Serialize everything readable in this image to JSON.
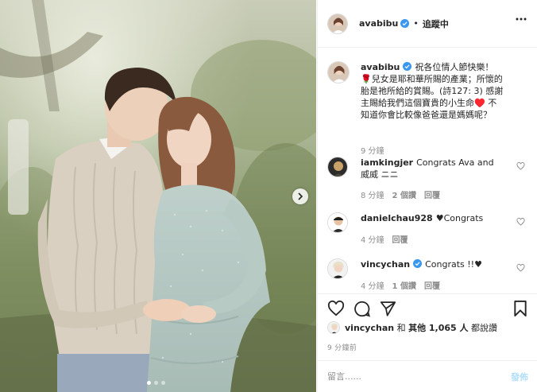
{
  "header": {
    "username": "avabibu",
    "separator": "•",
    "follow_status": "追蹤中",
    "more_icon": "more-horizontal-icon"
  },
  "caption": {
    "username": "avabibu",
    "text": "祝各位情人節快樂！🌹兒女是耶和華所賜的產業；所懷的胎是祂所給的賞賜。(詩127: 3) 感謝主賜給我們這個寶貴的小生命♥️ 不知道你會比較像爸爸還是媽媽呢？",
    "time": "9 分鐘"
  },
  "comments": [
    {
      "username": "iamkingjer",
      "text": "Congrats Ava and 威威 ニニ",
      "time": "8 分鐘",
      "likes": "2 個讚",
      "reply": "回覆"
    },
    {
      "username": "danielchau928",
      "text": "♥Congrats",
      "time": "4 分鐘",
      "reply": "回覆"
    },
    {
      "username": "vincychan",
      "text": "Congrats !!♥",
      "time": "4 分鐘",
      "likes": "1 個讚",
      "reply": "回覆"
    }
  ],
  "likes_line": {
    "user": "vincychan",
    "connector": " 和 ",
    "others": "其他 1,065 人",
    "suffix": " 都說讚"
  },
  "time_ago": "9 分鐘前",
  "add_comment": {
    "placeholder": "留言......",
    "post_label": "發佈"
  },
  "colors": {
    "verified_blue": "#3897f0",
    "post_disabled": "#b2dffc",
    "border": "#efefef",
    "meta_gray": "#8e8e8e"
  },
  "carousel": {
    "current": 1,
    "total": 3
  }
}
